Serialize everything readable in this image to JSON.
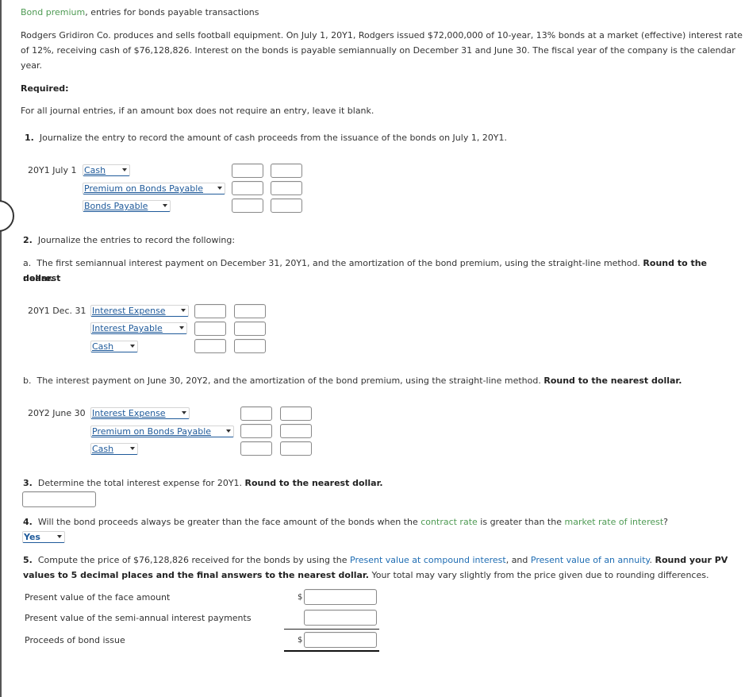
{
  "title": {
    "link": "Bond premium",
    "rest": ", entries for bonds payable transactions"
  },
  "intro": {
    "line1": "Rodgers Gridiron Co. produces and sells football equipment. On July 1, 20Y1, Rodgers issued $72,000,000 of 10-year, 13% bonds at a market (effective) interest rate",
    "line2": "of 12%, receiving cash of $76,128,826. Interest on the bonds is payable semiannually on December 31 and June 30. The fiscal year of the company is the calendar",
    "line3": "year."
  },
  "required_label": "Required:",
  "instruction": "For all journal entries, if an amount box does not require an entry, leave it blank.",
  "q1": {
    "num": "1.",
    "text": "Journalize the entry to record the amount of cash proceeds from the issuance of the bonds on July 1, 20Y1.",
    "date": "20Y1 July 1",
    "accounts": [
      "Cash",
      "Premium on Bonds Payable",
      "Bonds Payable"
    ]
  },
  "q2": {
    "num": "2.",
    "text": "Journalize the entries to record the following:",
    "a": {
      "letter": "a.",
      "text": "The first semiannual interest payment on December 31, 20Y1, and the amortization of the bond premium, using the straight-line method.",
      "bold": "Round to the nearest",
      "bold2": "dollar.",
      "date": "20Y1 Dec. 31",
      "accounts": [
        "Interest Expense",
        "Interest Payable",
        "Cash"
      ]
    },
    "b": {
      "letter": "b.",
      "text": "The interest payment on June 30, 20Y2, and the amortization of the bond premium, using the straight-line method.",
      "bold": "Round to the nearest dollar.",
      "date": "20Y2 June 30",
      "accounts": [
        "Interest Expense",
        "Premium on Bonds Payable",
        "Cash"
      ]
    }
  },
  "q3": {
    "num": "3.",
    "text": "Determine the total interest expense for 20Y1.",
    "bold": "Round to the nearest dollar.",
    "value": ""
  },
  "q4": {
    "num": "4.",
    "text1": "Will the bond proceeds always be greater than the face amount of the bonds when the",
    "link1": "contract rate",
    "text2": "is greater than the",
    "link2": "market rate of interest",
    "text3": "?",
    "selected": "Yes"
  },
  "q5": {
    "num": "5.",
    "text1": "Compute the price of $76,128,826 received for the bonds by using the",
    "link1": "Present value at compound interest",
    "text2": ", and",
    "link2": "Present value of an annuity",
    "text3": ".",
    "bold1": "Round your PV",
    "bold2": "values to 5 decimal places and the final answers to the nearest dollar.",
    "text4": "Your total may vary slightly from the price given due to rounding differences.",
    "rows": [
      {
        "label": "Present value of the face amount",
        "currency": "$",
        "value": ""
      },
      {
        "label": "Present value of the semi-annual interest payments",
        "currency": "",
        "value": ""
      },
      {
        "label": "Proceeds of bond issue",
        "currency": "$",
        "value": ""
      }
    ]
  },
  "colors": {
    "glossary_link": "#4e9a53",
    "reference_link": "#1f6db3",
    "dropdown_text": "#1f5a9a"
  }
}
